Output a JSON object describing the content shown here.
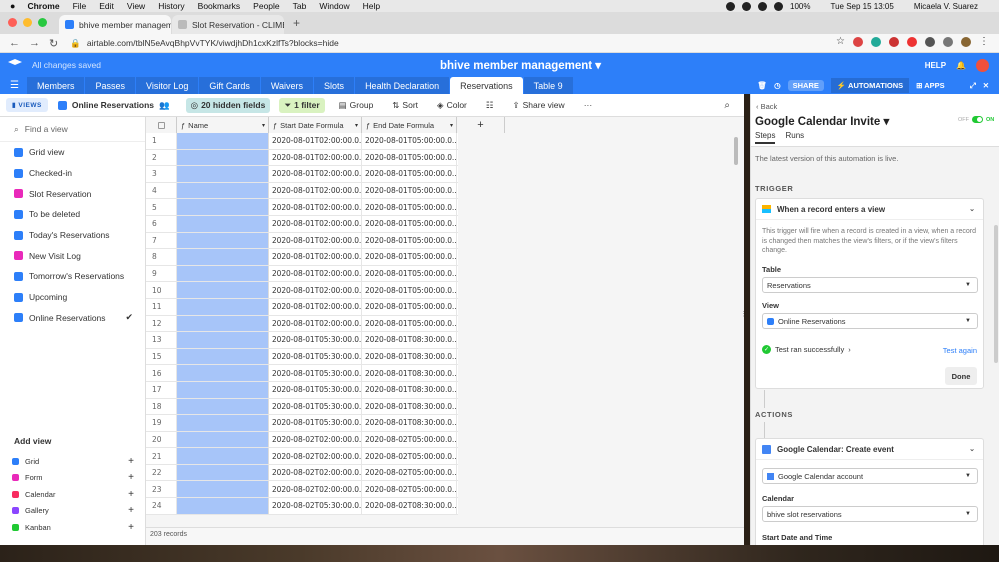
{
  "mac_menu": {
    "apple": "",
    "app": "Chrome",
    "items": [
      "File",
      "Edit",
      "View",
      "History",
      "Bookmarks",
      "People",
      "Tab",
      "Window",
      "Help"
    ],
    "battery": "100%",
    "datetime": "Tue Sep 15  13:05",
    "user": "Micaela V. Suarez"
  },
  "browser": {
    "tabs": [
      {
        "label": "bhive member management: R"
      },
      {
        "label": "Slot Reservation - CLIMBING |"
      }
    ],
    "new_tab": "+",
    "url": "airtable.com/tblN5eAvqBhpVvTYK/viwdjhDh1cxKzlfTs?blocks=hide"
  },
  "airtable": {
    "saved_status": "All changes saved",
    "base_title": "bhive member management",
    "help": "HELP",
    "table_tabs": [
      "Members",
      "Passes",
      "Visitor Log",
      "Gift Cards",
      "Waivers",
      "Slots",
      "Health Declaration",
      "Reservations",
      "Table 9"
    ],
    "share": "SHARE",
    "automations": "AUTOMATIONS",
    "apps": "APPS"
  },
  "viewbar": {
    "views": "VIEWS",
    "view_name": "Online Reservations",
    "hidden_fields": "20 hidden fields",
    "filter": "1 filter",
    "group": "Group",
    "sort": "Sort",
    "color": "Color",
    "share_view": "Share view",
    "more": "···"
  },
  "sidebar": {
    "find": "Find a view",
    "views": [
      {
        "label": "Grid view",
        "color": "#2d7ff9"
      },
      {
        "label": "Checked-in",
        "color": "#2d7ff9"
      },
      {
        "label": "Slot Reservation",
        "color": "#e929ba"
      },
      {
        "label": "To be deleted",
        "color": "#2d7ff9"
      },
      {
        "label": "Today's Reservations",
        "color": "#2d7ff9"
      },
      {
        "label": "New Visit Log",
        "color": "#e929ba"
      },
      {
        "label": "Tomorrow's Reservations",
        "color": "#2d7ff9"
      },
      {
        "label": "Upcoming",
        "color": "#2d7ff9"
      },
      {
        "label": "Online Reservations",
        "color": "#2d7ff9"
      }
    ],
    "add_view": "Add view",
    "add_items": [
      {
        "label": "Grid",
        "color": "#2d7ff9"
      },
      {
        "label": "Form",
        "color": "#e929ba"
      },
      {
        "label": "Calendar",
        "color": "#f82b60"
      },
      {
        "label": "Gallery",
        "color": "#8b46ff"
      },
      {
        "label": "Kanban",
        "color": "#20c933"
      }
    ]
  },
  "grid": {
    "columns": [
      "Name",
      "Start Date Formula",
      "End Date Formula"
    ],
    "add_column": "+",
    "rows": [
      [
        "1",
        "2020-08-01T02:00:00.0...",
        "2020-08-01T05:00:00.0..."
      ],
      [
        "2",
        "2020-08-01T02:00:00.0...",
        "2020-08-01T05:00:00.0..."
      ],
      [
        "3",
        "2020-08-01T02:00:00.0...",
        "2020-08-01T05:00:00.0..."
      ],
      [
        "4",
        "2020-08-01T02:00:00.0...",
        "2020-08-01T05:00:00.0..."
      ],
      [
        "5",
        "2020-08-01T02:00:00.0...",
        "2020-08-01T05:00:00.0..."
      ],
      [
        "6",
        "2020-08-01T02:00:00.0...",
        "2020-08-01T05:00:00.0..."
      ],
      [
        "7",
        "2020-08-01T02:00:00.0...",
        "2020-08-01T05:00:00.0..."
      ],
      [
        "8",
        "2020-08-01T02:00:00.0...",
        "2020-08-01T05:00:00.0..."
      ],
      [
        "9",
        "2020-08-01T02:00:00.0...",
        "2020-08-01T05:00:00.0..."
      ],
      [
        "10",
        "2020-08-01T02:00:00.0...",
        "2020-08-01T05:00:00.0..."
      ],
      [
        "11",
        "2020-08-01T02:00:00.0...",
        "2020-08-01T05:00:00.0..."
      ],
      [
        "12",
        "2020-08-01T02:00:00.0...",
        "2020-08-01T05:00:00.0..."
      ],
      [
        "13",
        "2020-08-01T05:30:00.0...",
        "2020-08-01T08:30:00.0..."
      ],
      [
        "15",
        "2020-08-01T05:30:00.0...",
        "2020-08-01T08:30:00.0..."
      ],
      [
        "16",
        "2020-08-01T05:30:00.0...",
        "2020-08-01T08:30:00.0..."
      ],
      [
        "17",
        "2020-08-01T05:30:00.0...",
        "2020-08-01T08:30:00.0..."
      ],
      [
        "18",
        "2020-08-01T05:30:00.0...",
        "2020-08-01T08:30:00.0..."
      ],
      [
        "19",
        "2020-08-01T05:30:00.0...",
        "2020-08-01T08:30:00.0..."
      ],
      [
        "20",
        "2020-08-02T02:00:00.0...",
        "2020-08-02T05:00:00.0..."
      ],
      [
        "21",
        "2020-08-02T02:00:00.0...",
        "2020-08-02T05:00:00.0..."
      ],
      [
        "22",
        "2020-08-02T02:00:00.0...",
        "2020-08-02T05:00:00.0..."
      ],
      [
        "23",
        "2020-08-02T02:00:00.0...",
        "2020-08-02T05:00:00.0..."
      ],
      [
        "24",
        "2020-08-02T05:30:00.0...",
        "2020-08-02T08:30:00.0..."
      ]
    ],
    "record_count": "203 records"
  },
  "automation": {
    "back": "‹ Back",
    "title": "Google Calendar Invite ▾",
    "toggle_off": "OFF",
    "toggle_on": "ON",
    "tabs": [
      "Steps",
      "Runs"
    ],
    "live_note": "The latest version of this automation is live.",
    "trigger_label": "TRIGGER",
    "trigger_title": "When a record enters a view",
    "trigger_desc": "This trigger will fire when a record is created in a view, when a record is changed then matches the view's filters, or if the view's filters change.",
    "table_label": "Table",
    "table_value": "Reservations",
    "view_label": "View",
    "view_value": "Online Reservations",
    "test_status": "Test ran successfully",
    "test_again": "Test again",
    "done": "Done",
    "actions_label": "ACTIONS",
    "action_title": "Google Calendar: Create event",
    "account_value": "Google Calendar account",
    "calendar_label": "Calendar",
    "calendar_value": "bhive slot reservations",
    "start_label": "Start Date and Time"
  }
}
